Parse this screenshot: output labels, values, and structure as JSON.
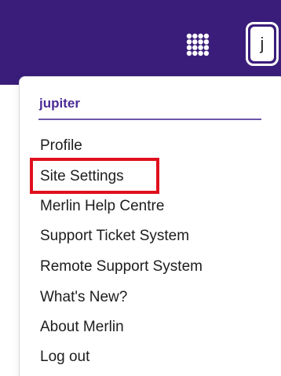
{
  "header": {
    "apps_icon": "grid-apps-icon",
    "avatar_initial": "j",
    "background_color": "#3a1d7a"
  },
  "user_menu": {
    "username": "jupiter",
    "items": [
      {
        "label": "Profile"
      },
      {
        "label": "Site Settings",
        "highlighted": true
      },
      {
        "label": "Merlin Help Centre"
      },
      {
        "label": "Support Ticket System"
      },
      {
        "label": "Remote Support System"
      },
      {
        "label": "What's New?"
      },
      {
        "label": "About Merlin"
      },
      {
        "label": "Log out"
      }
    ],
    "highlight_color": "#e0101e"
  }
}
